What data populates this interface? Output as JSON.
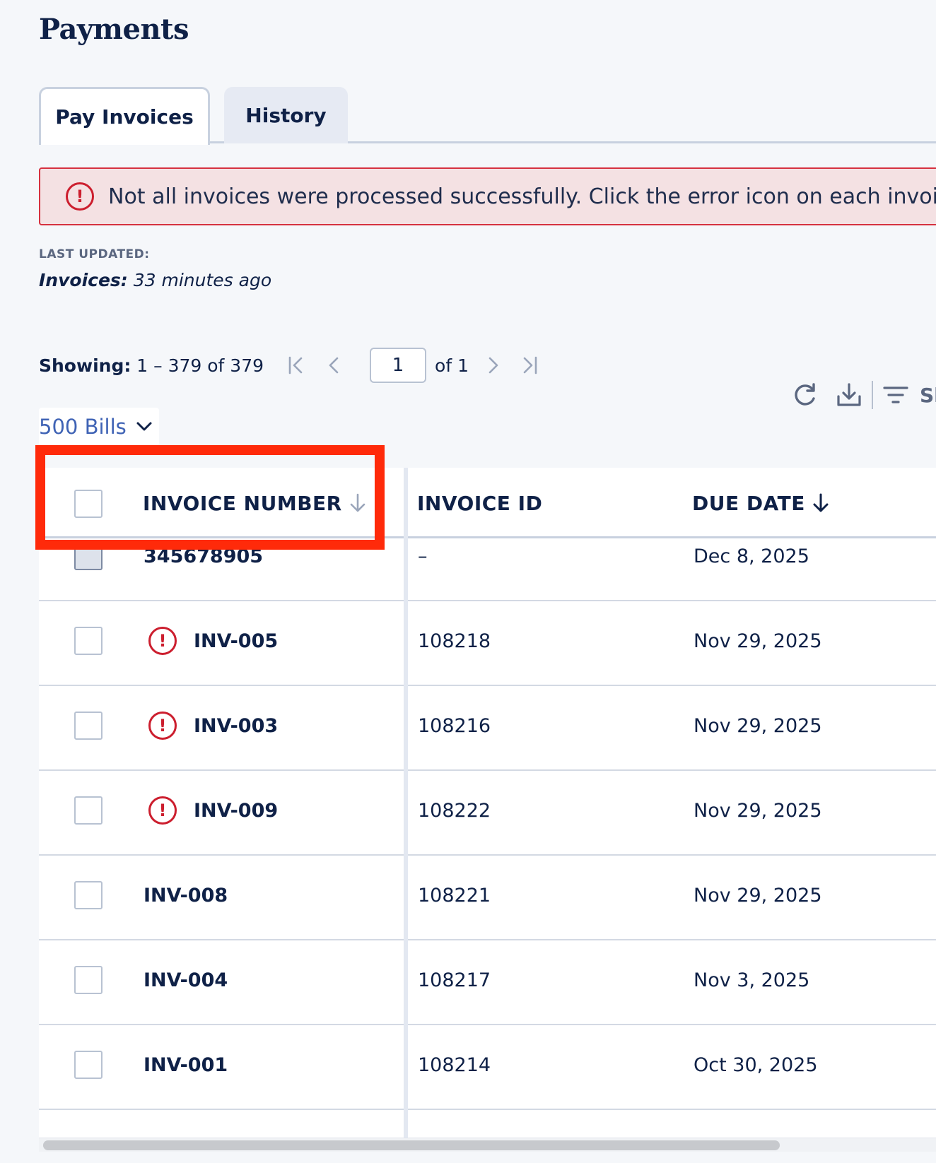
{
  "page": {
    "title": "Payments"
  },
  "tabs": [
    {
      "label": "Pay Invoices",
      "active": true
    },
    {
      "label": "History",
      "active": false
    }
  ],
  "banner": {
    "icon": "error-icon",
    "text": "Not all invoices were processed successfully. Click the error icon on each invoice for details.",
    "color": "#d6313f"
  },
  "last_updated": {
    "label": "LAST UPDATED:",
    "prefix": "Invoices:",
    "value": "33 minutes ago"
  },
  "pagination": {
    "showing_label": "Showing:",
    "range": "1 – 379 of 379",
    "current_page": "1",
    "of_pages": "of 1"
  },
  "toolbar": {
    "refresh_icon": "refresh-icon",
    "download_icon": "download-icon",
    "filter_icon": "filter-icon",
    "show_label": "Show"
  },
  "page_size": {
    "label": "500 Bills",
    "accent": "#3f63b5"
  },
  "table": {
    "columns": [
      {
        "label": "INVOICE NUMBER",
        "sort": "desc"
      },
      {
        "label": "INVOICE ID"
      },
      {
        "label": "DUE DATE",
        "sort": "desc"
      }
    ],
    "rows": [
      {
        "number": "345678905",
        "id": "–",
        "due": "Dec 8, 2025",
        "error": false,
        "checked": "indeterminate"
      },
      {
        "number": "INV-005",
        "id": "108218",
        "due": "Nov 29, 2025",
        "error": true
      },
      {
        "number": "INV-003",
        "id": "108216",
        "due": "Nov 29, 2025",
        "error": true
      },
      {
        "number": "INV-009",
        "id": "108222",
        "due": "Nov 29, 2025",
        "error": true
      },
      {
        "number": "INV-008",
        "id": "108221",
        "due": "Nov 29, 2025",
        "error": false
      },
      {
        "number": "INV-004",
        "id": "108217",
        "due": "Nov 3, 2025",
        "error": false
      },
      {
        "number": "INV-001",
        "id": "108214",
        "due": "Oct 30, 2025",
        "error": false
      }
    ]
  },
  "error_glyph": "!",
  "colors": {
    "navy": "#0f2147",
    "error": "#cc1e2e",
    "highlight": "#ff2a0a"
  }
}
